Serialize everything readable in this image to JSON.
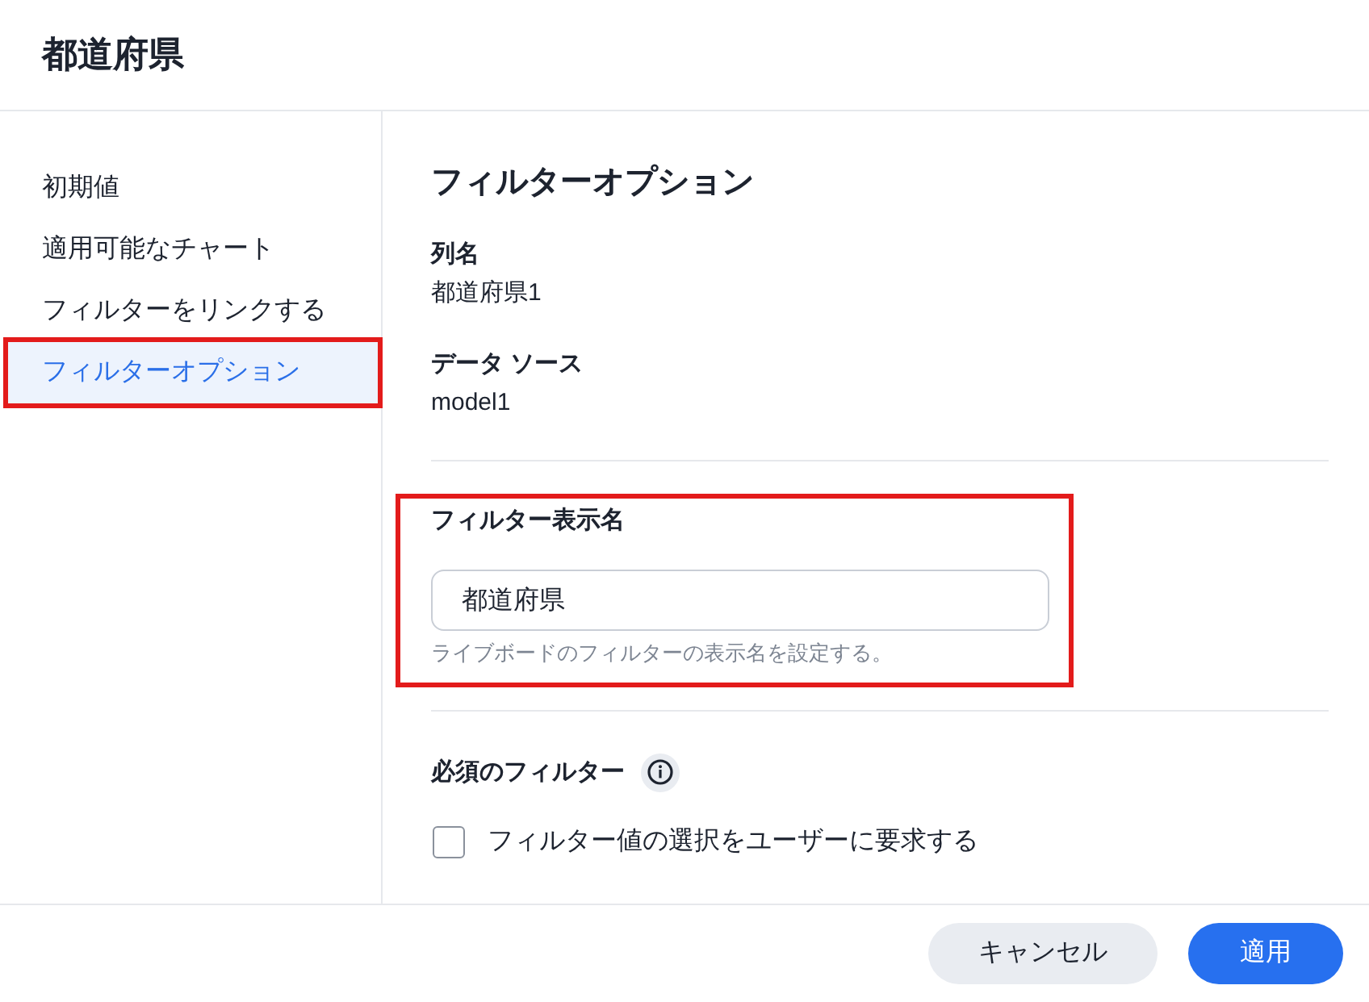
{
  "dialog": {
    "title": "都道府県"
  },
  "sidebar": {
    "items": [
      {
        "label": "初期値",
        "selected": false,
        "highlighted": false
      },
      {
        "label": "適用可能なチャート",
        "selected": false,
        "highlighted": false
      },
      {
        "label": "フィルターをリンクする",
        "selected": false,
        "highlighted": false
      },
      {
        "label": "フィルターオプション",
        "selected": true,
        "highlighted": true
      }
    ]
  },
  "panel": {
    "title": "フィルターオプション",
    "fields": [
      {
        "label": "列名",
        "value": "都道府県1"
      },
      {
        "label": "データ ソース",
        "value": "model1"
      }
    ],
    "display_name": {
      "label": "フィルター表示名",
      "value": "都道府県",
      "helper": "ライブボードのフィルターの表示名を設定する。",
      "highlighted": true
    },
    "required_filter": {
      "label": "必須のフィルター",
      "checkbox": {
        "label": "フィルター値の選択をユーザーに要求する",
        "checked": false
      }
    }
  },
  "buttons": [
    {
      "label": "キャンセル",
      "kind": "secondary"
    },
    {
      "label": "適用",
      "kind": "primary"
    }
  ]
}
